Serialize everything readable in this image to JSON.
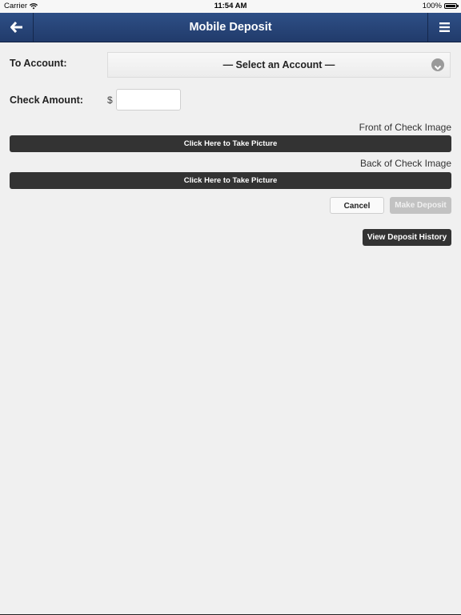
{
  "status_bar": {
    "carrier": "Carrier",
    "time": "11:54 AM",
    "battery": "100%"
  },
  "header": {
    "title": "Mobile Deposit",
    "back_icon": "arrow-left-icon",
    "menu_icon": "hamburger-menu-icon"
  },
  "form": {
    "to_account_label": "To Account:",
    "account_select_value": "— Select an Account —",
    "check_amount_label": "Check Amount:",
    "currency_symbol": "$",
    "amount_value": "",
    "front_caption": "Front of Check Image",
    "front_button": "Click Here to Take Picture",
    "back_caption": "Back of Check Image",
    "back_button": "Click Here to Take Picture"
  },
  "actions": {
    "cancel": "Cancel",
    "make_deposit": "Make Deposit",
    "view_history": "View Deposit History"
  },
  "colors": {
    "header": "#26427a",
    "dark_button": "#333333",
    "background": "#f0f0f0"
  }
}
